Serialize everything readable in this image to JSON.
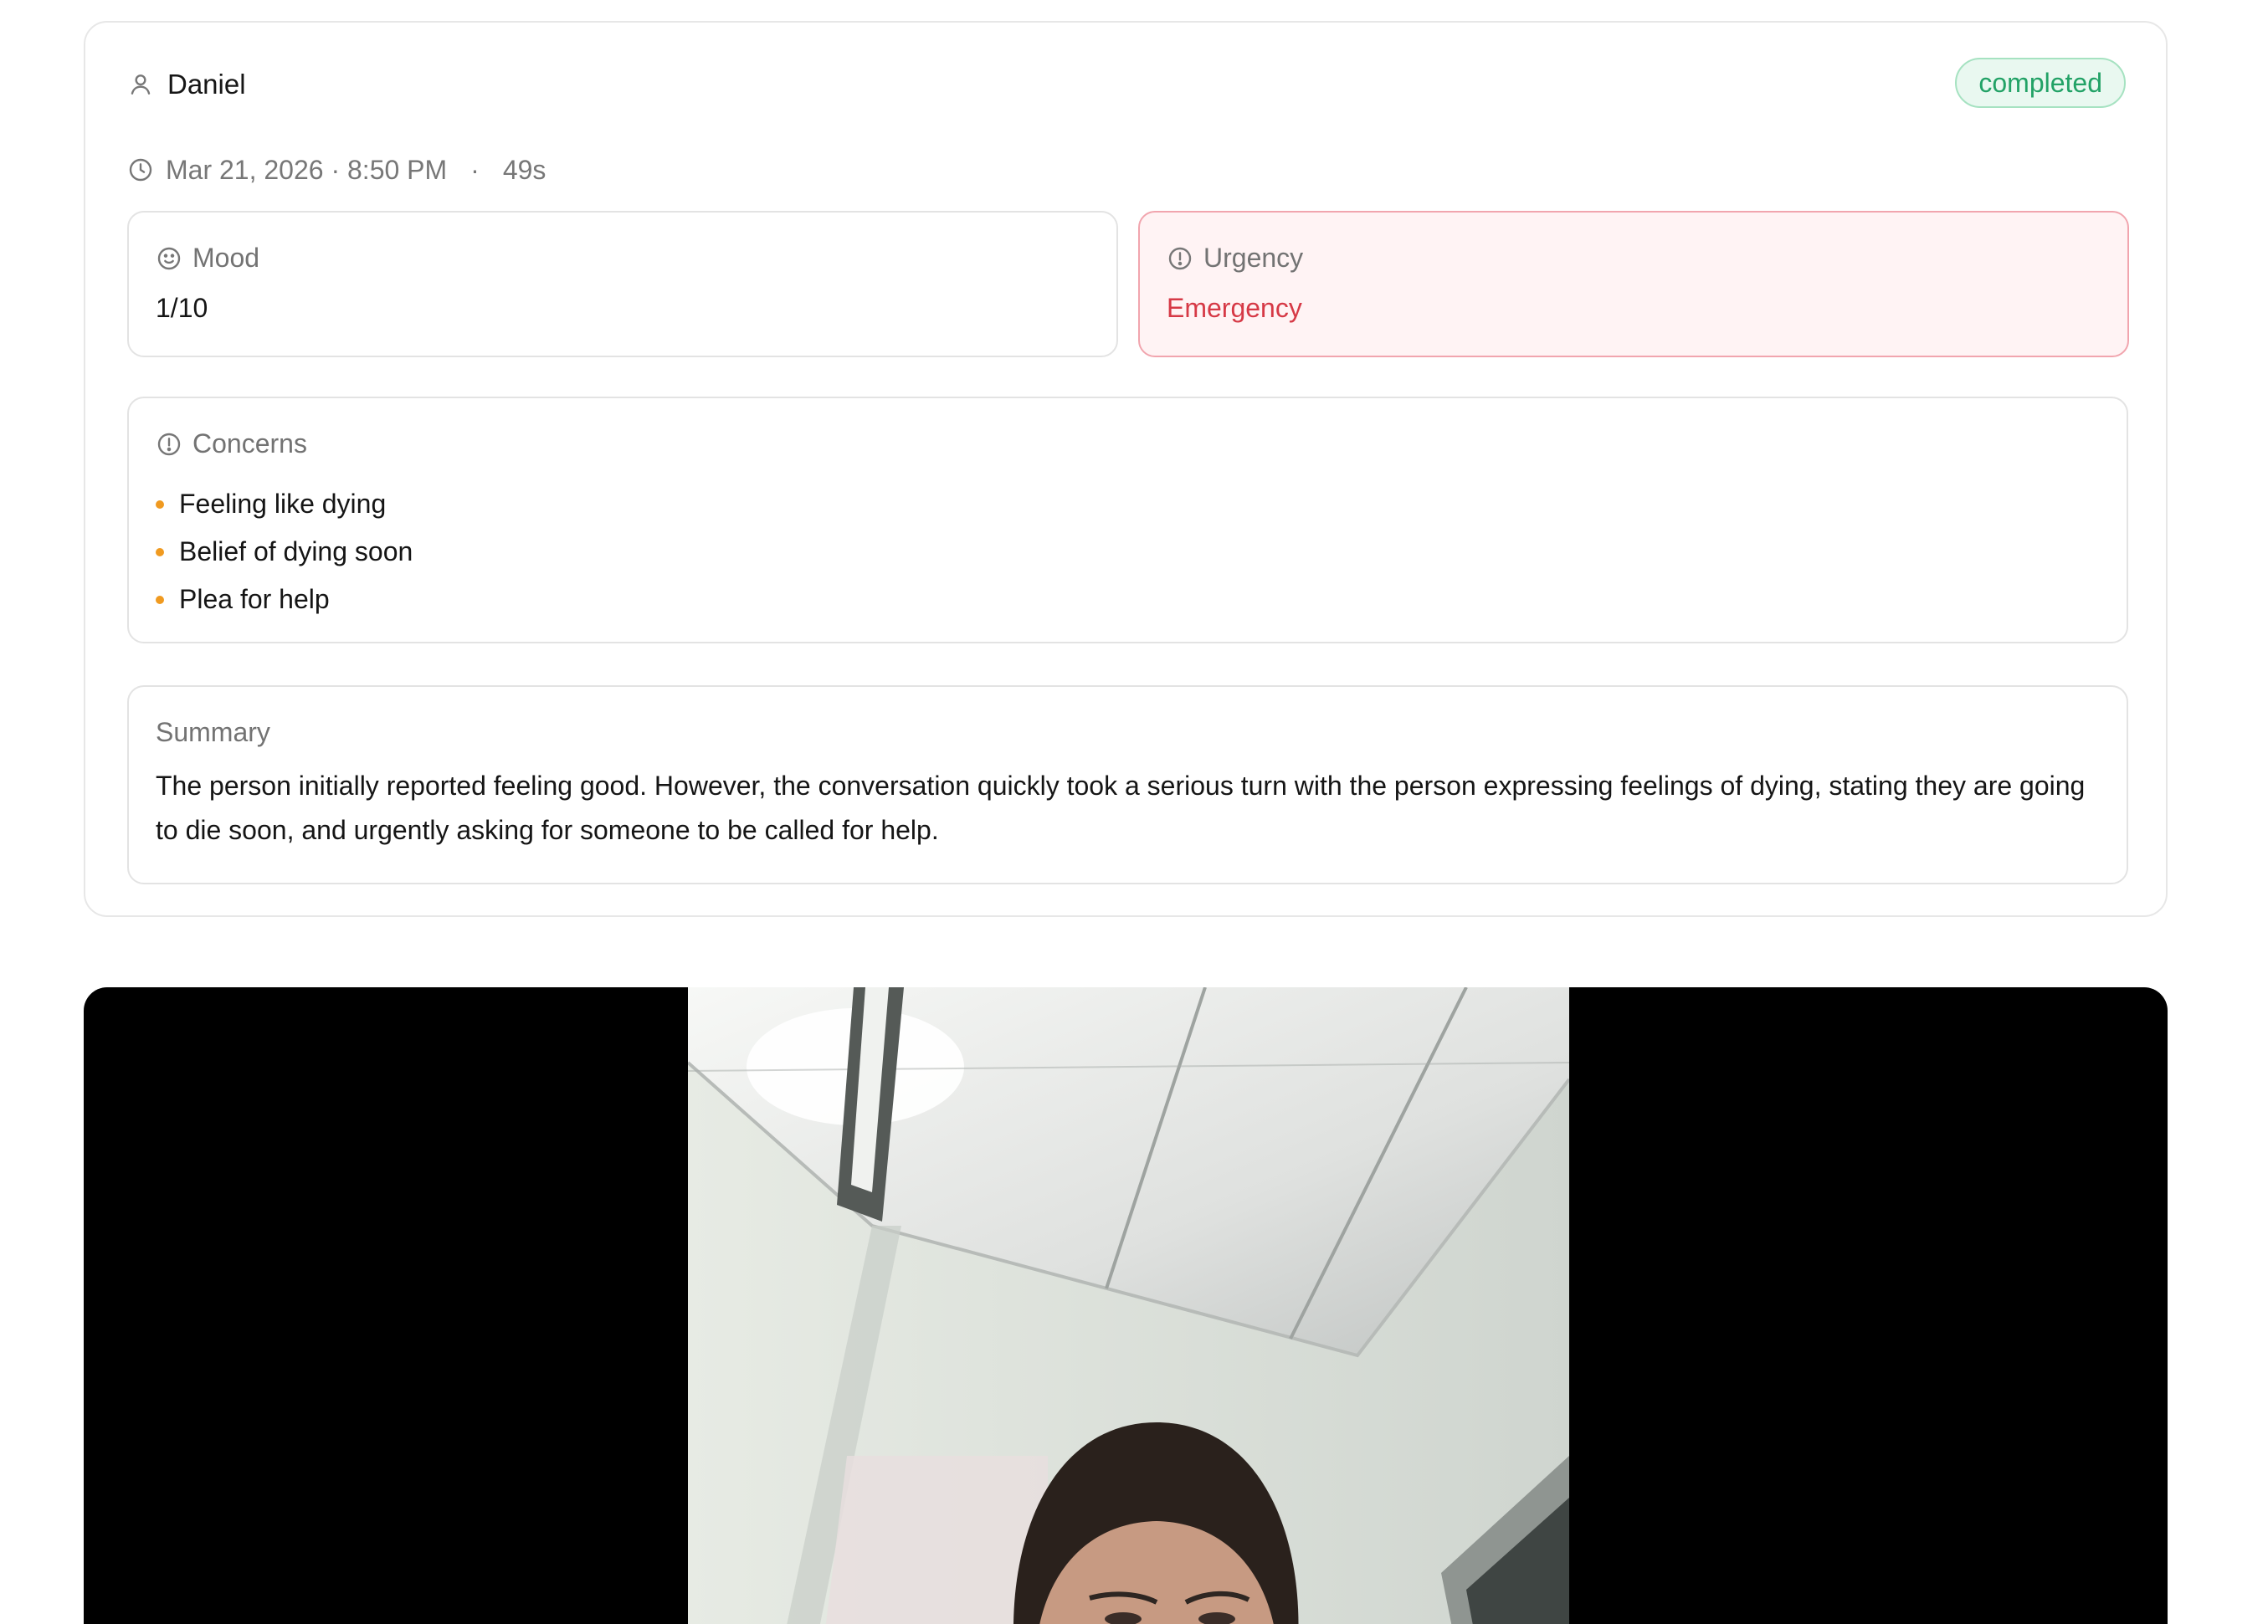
{
  "session": {
    "user_icon": "user-icon",
    "user_name": "Daniel",
    "status": "completed",
    "clock_icon": "clock-icon",
    "datetime": "Mar 21, 2026 · 8:50 PM",
    "separator": "·",
    "duration": "49s",
    "colors": {
      "status_text": "#22a266",
      "status_bg": "#e9f8f0",
      "urgency_text": "#d63946",
      "urgency_bg": "#fff3f4",
      "bullet": "#f09a20"
    }
  },
  "mood": {
    "icon": "smile-icon",
    "label": "Mood",
    "value": "1/10"
  },
  "urgency": {
    "icon": "alert-circle-icon",
    "label": "Urgency",
    "value": "Emergency"
  },
  "concerns": {
    "icon": "alert-circle-icon",
    "label": "Concerns",
    "items": [
      "Feeling like dying",
      "Belief of dying soon",
      "Plea for help"
    ]
  },
  "summary": {
    "label": "Summary",
    "text": "The person initially reported feeling good. However, the conversation quickly took a serious turn with the person expressing feelings of dying, stating they are going to die soon, and urgently asking for someone to be called for help."
  }
}
